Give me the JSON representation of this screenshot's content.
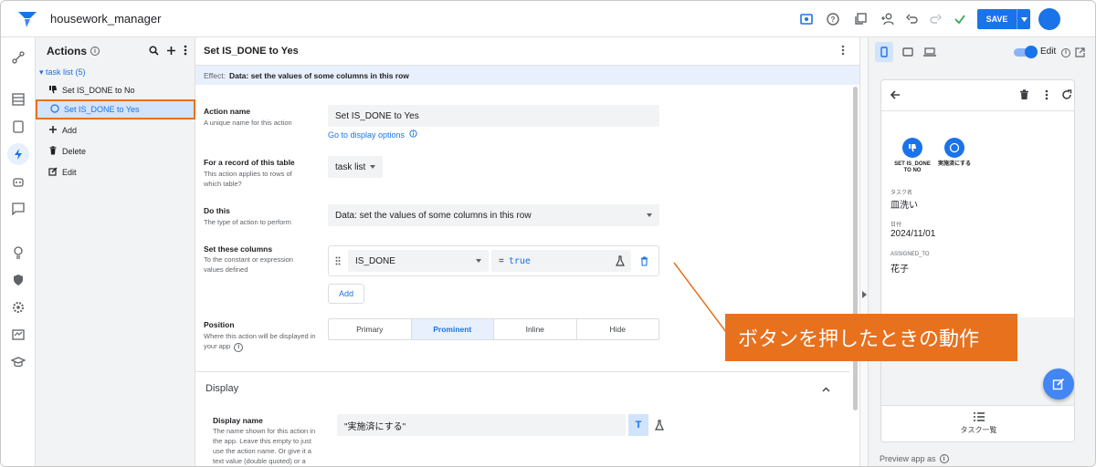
{
  "app": {
    "name": "housework_manager"
  },
  "toolbar": {
    "save_label": "SAVE"
  },
  "actions_panel": {
    "title": "Actions",
    "group": "task list (5)",
    "items": [
      {
        "label": "Set IS_DONE to No",
        "icon": "thumbs-down-icon"
      },
      {
        "label": "Set IS_DONE to Yes",
        "icon": "circle-icon",
        "selected": true
      },
      {
        "label": "Add",
        "icon": "plus-icon"
      },
      {
        "label": "Delete",
        "icon": "trash-icon"
      },
      {
        "label": "Edit",
        "icon": "edit-icon"
      }
    ]
  },
  "editor": {
    "title": "Set IS_DONE to Yes",
    "effect_key": "Effect:",
    "effect_value": "Data: set the values of some columns in this row",
    "action_name": {
      "label": "Action name",
      "help": "A unique name for this action",
      "value": "Set IS_DONE to Yes",
      "link": "Go to display options"
    },
    "table": {
      "label": "For a record of this table",
      "help": "This action applies to rows of which table?",
      "value": "task list"
    },
    "do_this": {
      "label": "Do this",
      "help": "The type of action to perform",
      "value": "Data: set the values of some columns in this row"
    },
    "set_columns": {
      "label": "Set these columns",
      "help": "To the constant or expression values defined",
      "column": "IS_DONE",
      "eq": "=",
      "expr": "true",
      "add": "Add"
    },
    "position": {
      "label": "Position",
      "help": "Where this action will be displayed in your app",
      "options": [
        "Primary",
        "Prominent",
        "Inline",
        "Hide"
      ],
      "selected": "Prominent"
    },
    "display": {
      "section": "Display",
      "name_label": "Display name",
      "name_help": "The name shown for this action in the app. Leave this empty to just use the action name. Or give it a text value (double quoted) or a",
      "name_value": "\"実施済にする\""
    }
  },
  "preview": {
    "edit_label": "Edit",
    "buttons": [
      {
        "caption": "SET IS_DONE TO NO",
        "icon": "thumbs-down-icon"
      },
      {
        "caption": "実施済にする",
        "icon": "circle-icon"
      }
    ],
    "fields": [
      {
        "label": "タスク名",
        "value": "皿洗い"
      },
      {
        "label": "日付",
        "value": "2024/11/01"
      },
      {
        "label": "ASSIGNED_TO",
        "value": "花子"
      }
    ],
    "nav_label": "タスク一覧",
    "preview_as": "Preview app as"
  },
  "annotation": {
    "text": "ボタンを押したときの動作",
    "color": "#e8711e"
  },
  "colors": {
    "accent": "#1a73e8",
    "highlight": "#e8711e"
  }
}
